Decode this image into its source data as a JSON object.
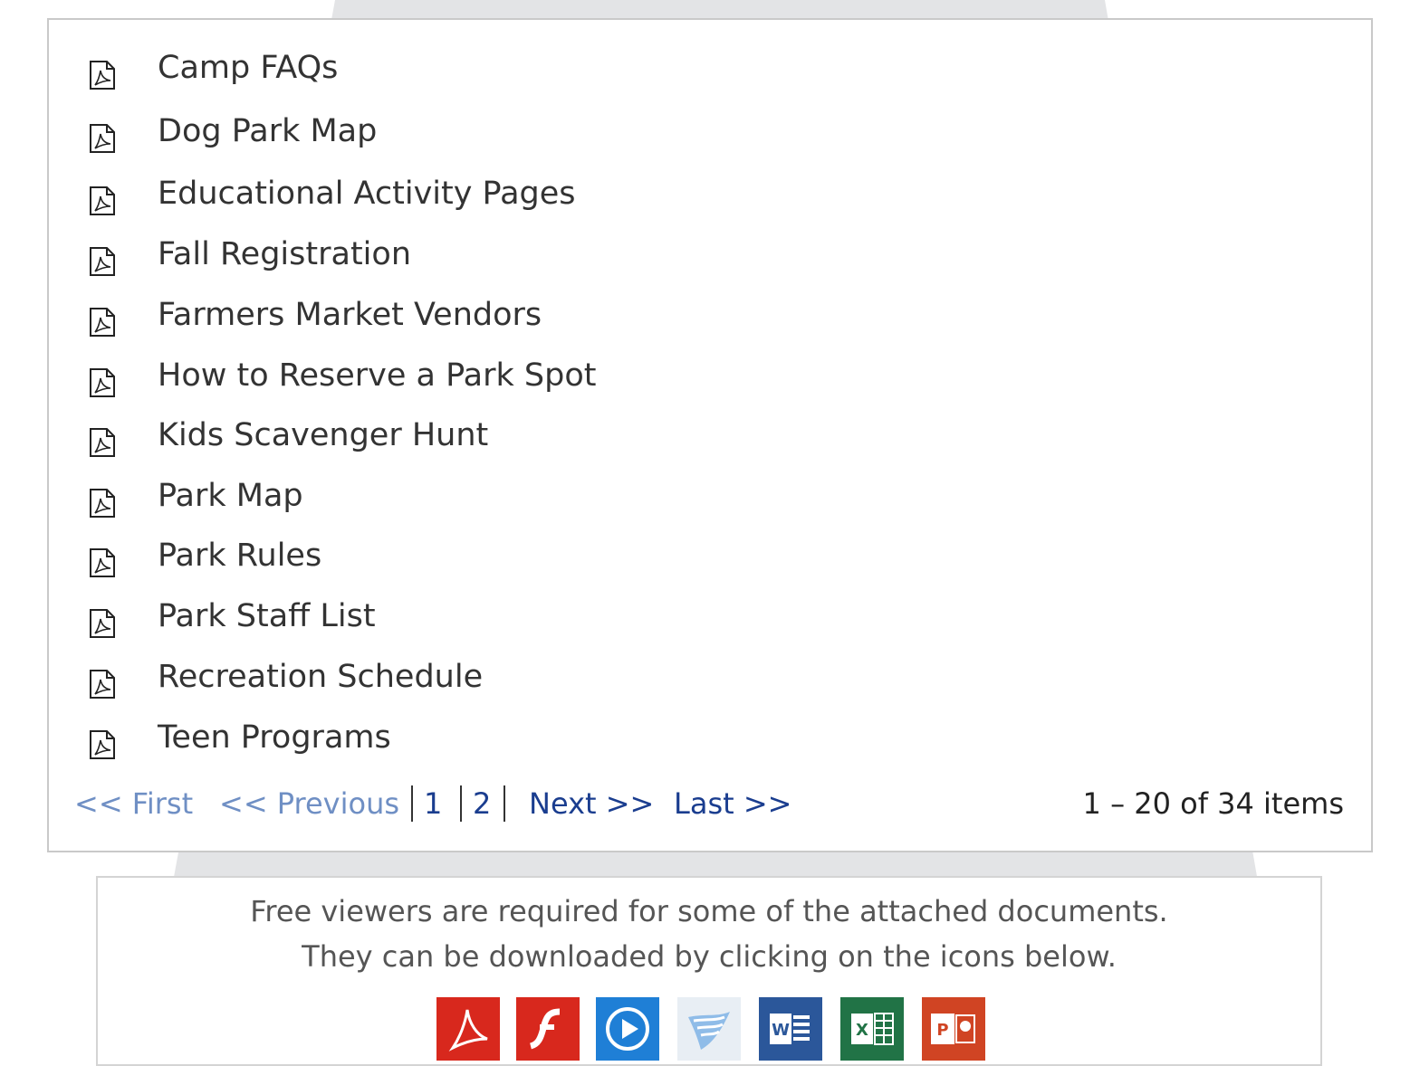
{
  "documents": {
    "items": [
      {
        "label": "Camp FAQs",
        "icon": "pdf-icon"
      },
      {
        "label": "Dog Park Map",
        "icon": "pdf-icon"
      },
      {
        "label": "Educational Activity Pages",
        "icon": "pdf-icon"
      },
      {
        "label": "Fall Registration",
        "icon": "pdf-icon"
      },
      {
        "label": "Farmers Market Vendors",
        "icon": "pdf-icon"
      },
      {
        "label": "How to Reserve a Park Spot",
        "icon": "pdf-icon"
      },
      {
        "label": "Kids Scavenger Hunt",
        "icon": "pdf-icon"
      },
      {
        "label": "Park Map",
        "icon": "pdf-icon"
      },
      {
        "label": "Park Rules",
        "icon": "pdf-icon"
      },
      {
        "label": "Park Staff List",
        "icon": "pdf-icon"
      },
      {
        "label": "Recreation Schedule",
        "icon": "pdf-icon"
      },
      {
        "label": "Teen Programs",
        "icon": "pdf-icon"
      }
    ]
  },
  "pager": {
    "first": "<< First",
    "previous": "<< Previous",
    "page1": "1",
    "page2": "2",
    "next": "Next >>",
    "last": "Last >>",
    "count": "1 – 20 of 34 items"
  },
  "viewers": {
    "line1": "Free viewers are required for some of the attached documents.",
    "line2": "They can be downloaded by clicking on the icons below.",
    "icons": [
      "adobe-reader-icon",
      "flash-player-icon",
      "windows-media-player-icon",
      "silverlight-icon",
      "word-viewer-icon",
      "excel-viewer-icon",
      "powerpoint-viewer-icon"
    ]
  },
  "colors": {
    "link_active": "#1a3d8f",
    "link_inactive": "#6f8fc4",
    "adobe": "#d8281d",
    "flash": "#d8281d",
    "media": "#1f7fd6",
    "word": "#2b579a",
    "excel": "#217346",
    "powerpoint": "#d04423"
  }
}
